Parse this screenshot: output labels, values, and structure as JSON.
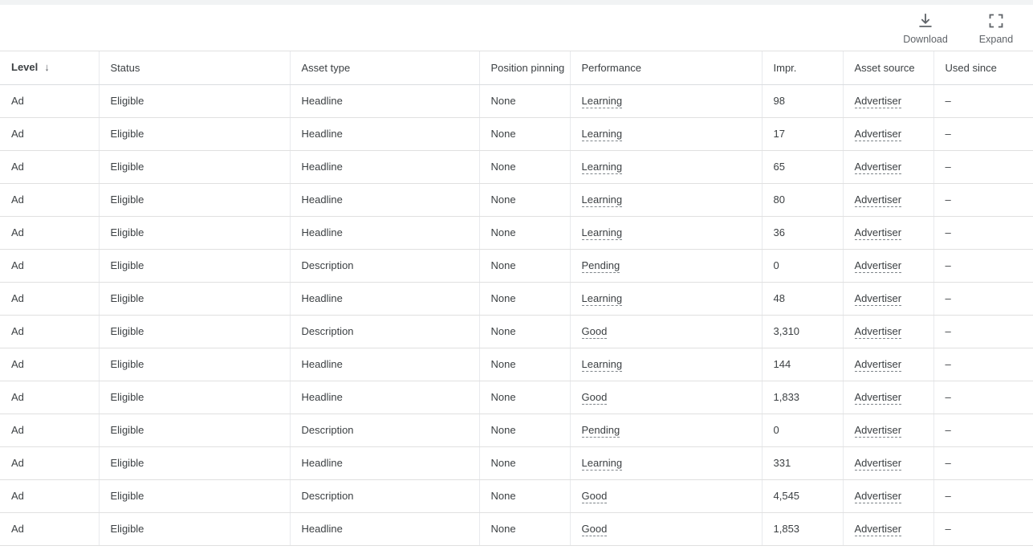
{
  "top_strip": {},
  "toolbar": {
    "actions": [
      {
        "icon": "download-icon",
        "label": "Download"
      },
      {
        "icon": "expand-icon",
        "label": "Expand"
      }
    ]
  },
  "table": {
    "sort": {
      "column": "Level",
      "direction": "descending",
      "arrow_glyph": "↓"
    },
    "columns": [
      {
        "key": "level",
        "label": "Level",
        "align": "left",
        "sorted": true
      },
      {
        "key": "status",
        "label": "Status",
        "align": "left",
        "sorted": false
      },
      {
        "key": "asset_type",
        "label": "Asset type",
        "align": "left",
        "sorted": false
      },
      {
        "key": "pinning",
        "label": "Position pinning",
        "align": "left",
        "sorted": false
      },
      {
        "key": "performance",
        "label": "Performance",
        "align": "left",
        "sorted": false
      },
      {
        "key": "impr",
        "label": "Impr.",
        "align": "right",
        "sorted": false
      },
      {
        "key": "source",
        "label": "Asset source",
        "align": "left",
        "sorted": false
      },
      {
        "key": "used_since",
        "label": "Used since",
        "align": "left",
        "sorted": false
      }
    ],
    "rows": [
      {
        "level": "Ad",
        "status": "Eligible",
        "asset_type": "Headline",
        "pinning": "None",
        "performance": "Learning",
        "impr": "98",
        "source": "Advertiser",
        "used_since": "–"
      },
      {
        "level": "Ad",
        "status": "Eligible",
        "asset_type": "Headline",
        "pinning": "None",
        "performance": "Learning",
        "impr": "17",
        "source": "Advertiser",
        "used_since": "–"
      },
      {
        "level": "Ad",
        "status": "Eligible",
        "asset_type": "Headline",
        "pinning": "None",
        "performance": "Learning",
        "impr": "65",
        "source": "Advertiser",
        "used_since": "–"
      },
      {
        "level": "Ad",
        "status": "Eligible",
        "asset_type": "Headline",
        "pinning": "None",
        "performance": "Learning",
        "impr": "80",
        "source": "Advertiser",
        "used_since": "–"
      },
      {
        "level": "Ad",
        "status": "Eligible",
        "asset_type": "Headline",
        "pinning": "None",
        "performance": "Learning",
        "impr": "36",
        "source": "Advertiser",
        "used_since": "–"
      },
      {
        "level": "Ad",
        "status": "Eligible",
        "asset_type": "Description",
        "pinning": "None",
        "performance": "Pending",
        "impr": "0",
        "source": "Advertiser",
        "used_since": "–"
      },
      {
        "level": "Ad",
        "status": "Eligible",
        "asset_type": "Headline",
        "pinning": "None",
        "performance": "Learning",
        "impr": "48",
        "source": "Advertiser",
        "used_since": "–"
      },
      {
        "level": "Ad",
        "status": "Eligible",
        "asset_type": "Description",
        "pinning": "None",
        "performance": "Good",
        "impr": "3,310",
        "source": "Advertiser",
        "used_since": "–"
      },
      {
        "level": "Ad",
        "status": "Eligible",
        "asset_type": "Headline",
        "pinning": "None",
        "performance": "Learning",
        "impr": "144",
        "source": "Advertiser",
        "used_since": "–"
      },
      {
        "level": "Ad",
        "status": "Eligible",
        "asset_type": "Headline",
        "pinning": "None",
        "performance": "Good",
        "impr": "1,833",
        "source": "Advertiser",
        "used_since": "–"
      },
      {
        "level": "Ad",
        "status": "Eligible",
        "asset_type": "Description",
        "pinning": "None",
        "performance": "Pending",
        "impr": "0",
        "source": "Advertiser",
        "used_since": "–"
      },
      {
        "level": "Ad",
        "status": "Eligible",
        "asset_type": "Headline",
        "pinning": "None",
        "performance": "Learning",
        "impr": "331",
        "source": "Advertiser",
        "used_since": "–"
      },
      {
        "level": "Ad",
        "status": "Eligible",
        "asset_type": "Description",
        "pinning": "None",
        "performance": "Good",
        "impr": "4,545",
        "source": "Advertiser",
        "used_since": "–"
      },
      {
        "level": "Ad",
        "status": "Eligible",
        "asset_type": "Headline",
        "pinning": "None",
        "performance": "Good",
        "impr": "1,853",
        "source": "Advertiser",
        "used_since": "–"
      }
    ]
  }
}
